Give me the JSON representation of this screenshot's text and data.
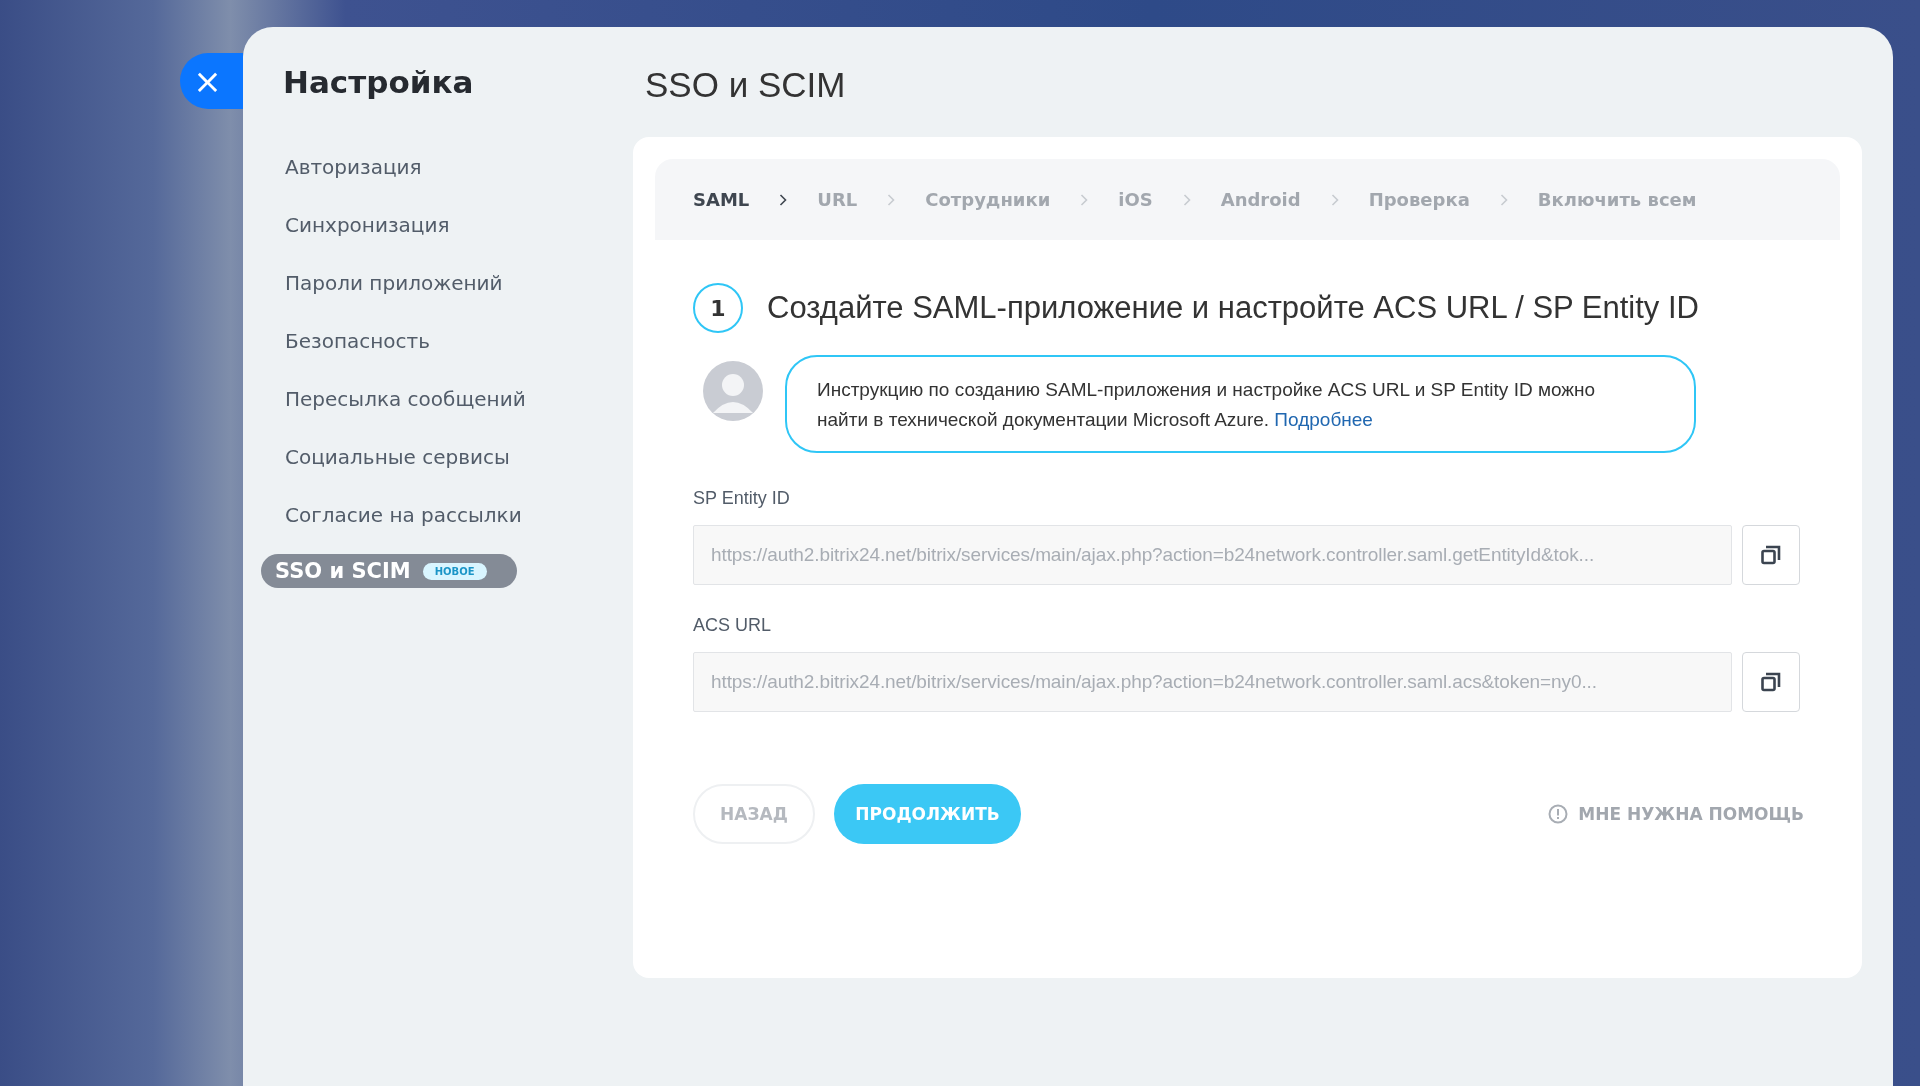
{
  "close_button": {
    "label": "×"
  },
  "sidebar": {
    "title": "Настройка",
    "items": [
      {
        "label": "Авторизация",
        "selected": false
      },
      {
        "label": "Синхронизация",
        "selected": false
      },
      {
        "label": "Пароли приложений",
        "selected": false
      },
      {
        "label": "Безопасность",
        "selected": false
      },
      {
        "label": "Пересылка сообщений",
        "selected": false
      },
      {
        "label": "Социальные сервисы",
        "selected": false
      },
      {
        "label": "Согласие на рассылки",
        "selected": false
      },
      {
        "label": "SSO и SCIM",
        "selected": true,
        "badge": "НОВОЕ"
      }
    ]
  },
  "page_title": "SSO и SCIM",
  "steps": [
    {
      "label": "SAML",
      "selected": true
    },
    {
      "label": "URL",
      "selected": false
    },
    {
      "label": "Сотрудники",
      "selected": false
    },
    {
      "label": "iOS",
      "selected": false
    },
    {
      "label": "Android",
      "selected": false
    },
    {
      "label": "Проверка",
      "selected": false
    },
    {
      "label": "Включить всем",
      "selected": false
    }
  ],
  "step_number": "1",
  "step_heading": "Создайте SAML-приложение и настройте ACS URL / SP Entity ID",
  "hint": {
    "text": "Инструкцию по созданию SAML-приложения и настройке ACS URL и SP Entity ID можно найти в технической документации Microsoft Azure.",
    "link": "Подробнее"
  },
  "fields": [
    {
      "label": "SP Entity ID",
      "value": "https://auth2.bitrix24.net/bitrix/services/main/ajax.php?action=b24network.controller.saml.getEntityId&tok..."
    },
    {
      "label": "ACS URL",
      "value": "https://auth2.bitrix24.net/bitrix/services/main/ajax.php?action=b24network.controller.saml.acs&token=ny0..."
    }
  ],
  "buttons": {
    "back": "НАЗАД",
    "continue": "ПРОДОЛЖИТЬ",
    "help": "МНЕ НУЖНА ПОМОЩЬ"
  }
}
